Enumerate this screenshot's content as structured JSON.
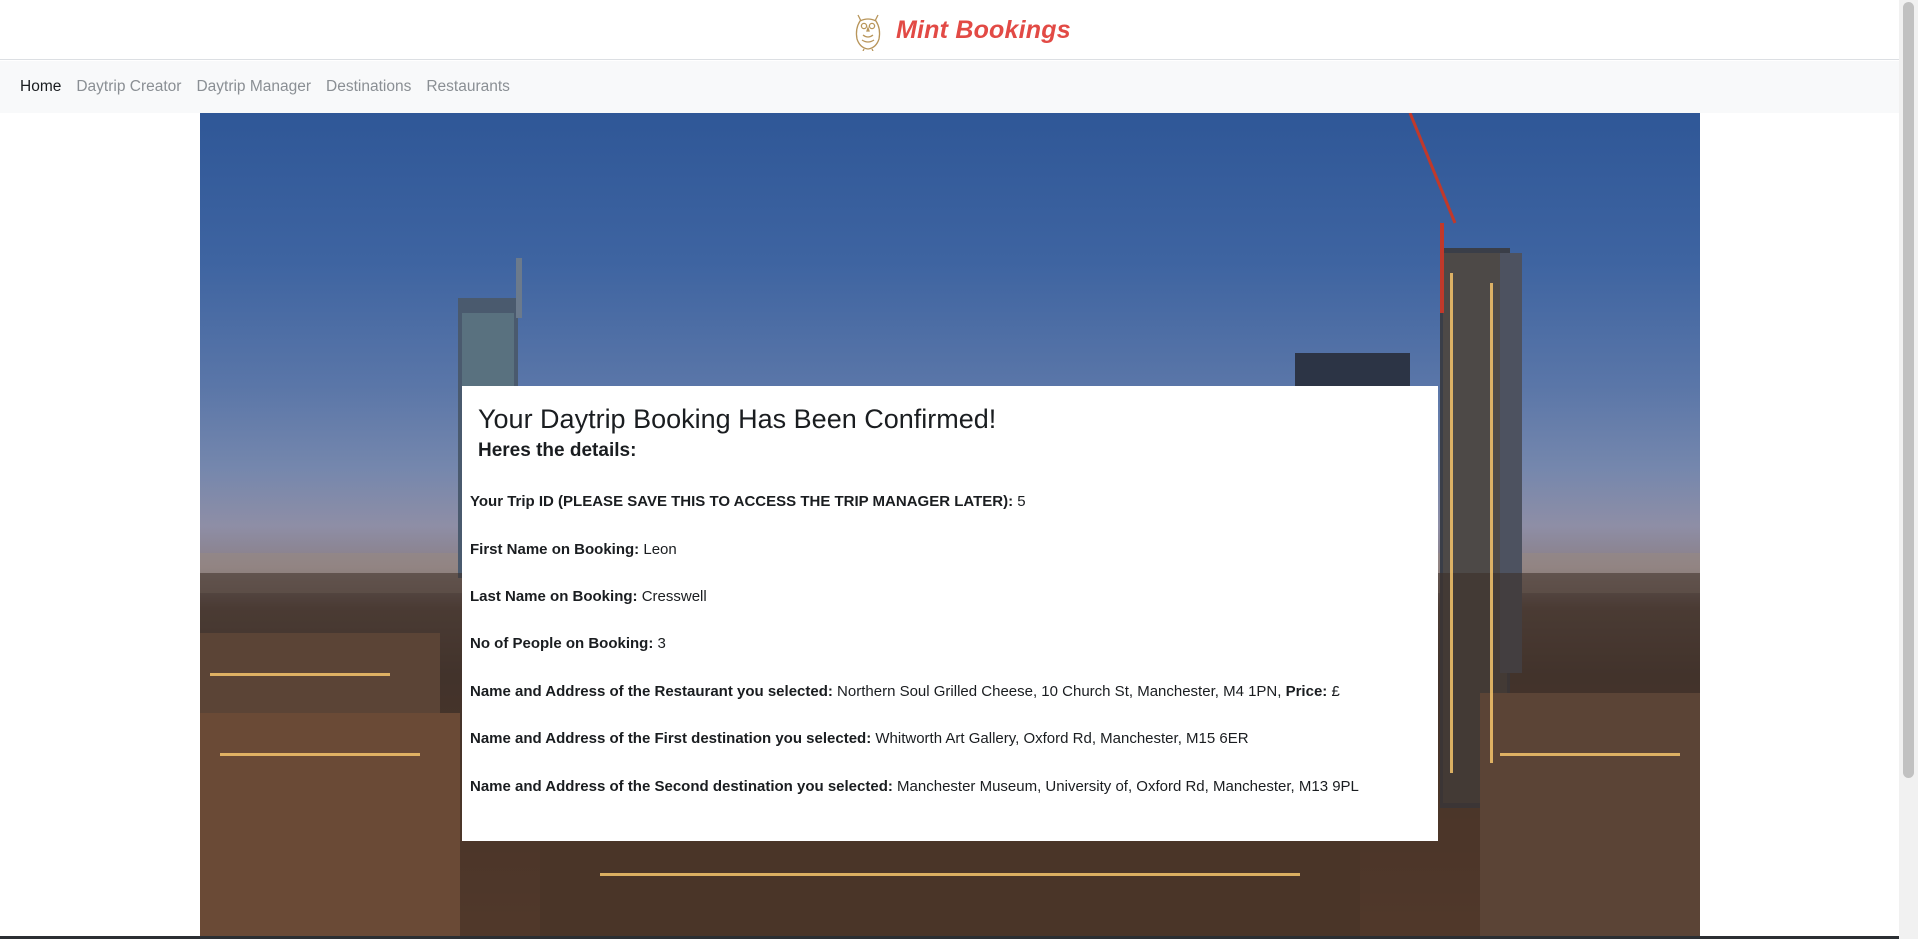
{
  "brand": {
    "name": "Mint Bookings",
    "logo_icon": "owl-icon",
    "color": "#e24a45"
  },
  "nav": {
    "items": [
      {
        "label": "Home",
        "active": true
      },
      {
        "label": "Daytrip Creator",
        "active": false
      },
      {
        "label": "Daytrip Manager",
        "active": false
      },
      {
        "label": "Destinations",
        "active": false
      },
      {
        "label": "Restaurants",
        "active": false
      }
    ]
  },
  "confirmation": {
    "title": "Your Daytrip Booking Has Been Confirmed!",
    "subtitle": "Heres the details:",
    "rows": [
      {
        "label": "Your Trip ID (PLEASE SAVE THIS TO ACCESS THE TRIP MANAGER LATER):",
        "value": "5"
      },
      {
        "label": "First Name on Booking:",
        "value": "Leon"
      },
      {
        "label": "Last Name on Booking:",
        "value": "Cresswell"
      },
      {
        "label": "No of People on Booking:",
        "value": "3"
      },
      {
        "label": "Name and Address of the Restaurant you selected:",
        "value": "Northern Soul Grilled Cheese, 10 Church St, Manchester, M4 1PN,",
        "extra_label": "Price:",
        "extra_value": "£"
      },
      {
        "label": "Name and Address of the First destination you selected:",
        "value": "Whitworth Art Gallery, Oxford Rd, Manchester, M15 6ER"
      },
      {
        "label": "Name and Address of the Second destination you selected:",
        "value": "Manchester Museum, University of, Oxford Rd, Manchester, M13 9PL"
      }
    ]
  }
}
